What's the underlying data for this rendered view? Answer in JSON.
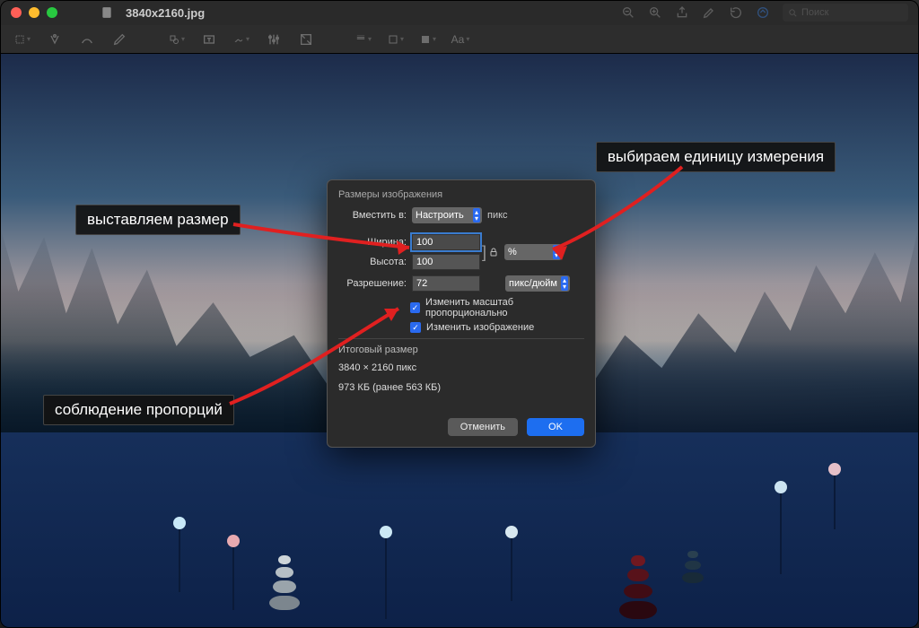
{
  "window": {
    "title": "3840x2160.jpg",
    "search_placeholder": "Поиск"
  },
  "dialog": {
    "title": "Размеры изображения",
    "fit_label": "Вместить в:",
    "fit_value": "Настроить",
    "fit_unit_suffix": "пикс",
    "width_label": "Ширина:",
    "width_value": "100",
    "height_label": "Высота:",
    "height_value": "100",
    "unit_value": "%",
    "resolution_label": "Разрешение:",
    "resolution_value": "72",
    "resolution_unit": "пикс/дюйм",
    "scale_proportional_label": "Изменить масштаб пропорционально",
    "resample_label": "Изменить изображение",
    "result_title": "Итоговый размер",
    "result_dimensions": "3840 × 2160 пикс",
    "result_filesize": "973 КБ (ранее 563 КБ)",
    "cancel": "Отменить",
    "ok": "OK"
  },
  "annotations": {
    "set_size": "выставляем размер",
    "choose_unit": "выбираем единицу измерения",
    "keep_proportions": "соблюдение пропорций"
  }
}
